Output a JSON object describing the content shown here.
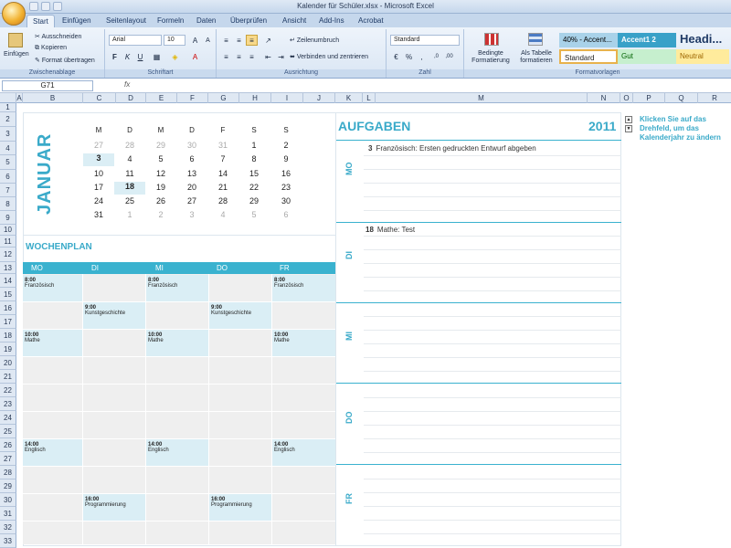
{
  "window": {
    "title": "Kalender für Schüler.xlsx - Microsoft Excel"
  },
  "tabs": [
    "Start",
    "Einfügen",
    "Seitenlayout",
    "Formeln",
    "Daten",
    "Überprüfen",
    "Ansicht",
    "Add-Ins",
    "Acrobat"
  ],
  "ribbon": {
    "clipboard": {
      "paste": "Einfügen",
      "cut": "Ausschneiden",
      "copy": "Kopieren",
      "format_painter": "Format übertragen",
      "label": "Zwischenablage"
    },
    "font": {
      "name": "Arial",
      "size": "10",
      "label": "Schriftart"
    },
    "alignment": {
      "wrap": "Zeilenumbruch",
      "merge": "Verbinden und zentrieren",
      "label": "Ausrichtung"
    },
    "number": {
      "format": "Standard",
      "label": "Zahl"
    },
    "styles": {
      "conditional": "Bedingte Formatierung",
      "as_table": "Als Tabelle formatieren",
      "label": "Formatvorlagen",
      "cells": [
        "40% - Accent...",
        "Accent1 2",
        "Headi...",
        "Standard",
        "Gut",
        "Neutral"
      ]
    }
  },
  "formula_bar": {
    "name_box": "G71",
    "fx": "fx",
    "value": ""
  },
  "columns": [
    "A",
    "B",
    "C",
    "D",
    "E",
    "F",
    "G",
    "H",
    "I",
    "J",
    "K",
    "L",
    "M",
    "N",
    "O",
    "P",
    "Q",
    "R"
  ],
  "rows": [
    "1",
    "2",
    "3",
    "4",
    "5",
    "6",
    "7",
    "8",
    "9",
    "10",
    "11",
    "12",
    "13",
    "14",
    "15",
    "16",
    "17",
    "18",
    "19",
    "20",
    "21",
    "22",
    "23",
    "24",
    "25",
    "26",
    "27",
    "28",
    "29",
    "30",
    "31",
    "32",
    "33"
  ],
  "calendar": {
    "month": "JANUAR",
    "weekday_headers": [
      "M",
      "D",
      "M",
      "D",
      "F",
      "S",
      "S"
    ],
    "weeks": [
      [
        "27",
        "28",
        "29",
        "30",
        "31",
        "1",
        "2"
      ],
      [
        "3",
        "4",
        "5",
        "6",
        "7",
        "8",
        "9"
      ],
      [
        "10",
        "11",
        "12",
        "13",
        "14",
        "15",
        "16"
      ],
      [
        "17",
        "18",
        "19",
        "20",
        "21",
        "22",
        "23"
      ],
      [
        "24",
        "25",
        "26",
        "27",
        "28",
        "29",
        "30"
      ],
      [
        "31",
        "1",
        "2",
        "3",
        "4",
        "5",
        "6"
      ]
    ]
  },
  "weekplan": {
    "title": "WOCHENPLAN",
    "days": [
      "MO",
      "DI",
      "MI",
      "DO",
      "FR"
    ],
    "entries": [
      {
        "time": "8:00",
        "subject": "Französisch"
      },
      {
        "time": "8:00",
        "subject": "Französisch"
      },
      {
        "time": "8:00",
        "subject": "Französisch"
      },
      {
        "time": "9:00",
        "subject": "Kunstgeschichte"
      },
      {
        "time": "9:00",
        "subject": "Kunstgeschichte"
      },
      {
        "time": "10:00",
        "subject": "Mathe"
      },
      {
        "time": "10:00",
        "subject": "Mathe"
      },
      {
        "time": "10:00",
        "subject": "Mathe"
      },
      {
        "time": "14:00",
        "subject": "Englisch"
      },
      {
        "time": "14:00",
        "subject": "Englisch"
      },
      {
        "time": "14:00",
        "subject": "Englisch"
      },
      {
        "time": "16:00",
        "subject": "Programmierung"
      },
      {
        "time": "16:00",
        "subject": "Programmierung"
      }
    ]
  },
  "tasks": {
    "title": "AUFGABEN",
    "year": "2011",
    "days": [
      "MO",
      "DI",
      "MI",
      "DO",
      "FR"
    ],
    "items": [
      {
        "day_num": "3",
        "text": "Französisch: Ersten gedruckten Entwurf abgeben"
      },
      {
        "day_num": "18",
        "text": "Mathe: Test"
      }
    ]
  },
  "hint": "Klicken Sie auf das Drehfeld, um das Kalenderjahr zu ändern",
  "colors": {
    "accent": "#3AAAC9",
    "header_bar": "#3AB2CF",
    "highlight": "#DBEEF5"
  }
}
